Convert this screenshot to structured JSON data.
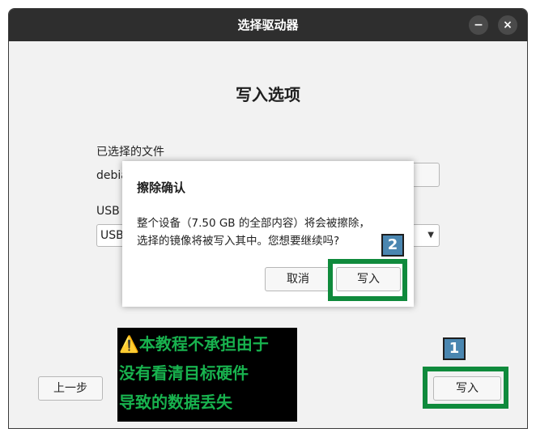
{
  "window": {
    "title": "选择驱动器",
    "minimize_label": "−",
    "close_label": "×"
  },
  "main": {
    "heading": "写入选项",
    "selected_file_label": "已选择的文件",
    "selected_file_value": "debia",
    "browse_button_label": "…",
    "usb_label": "USB",
    "usb_select_value": "USB",
    "prev_button_label": "上一步",
    "write_button_label": "写入",
    "step_badge": "1"
  },
  "warning": {
    "icon": "⚠️",
    "lines": [
      "本教程不承担由于",
      "没有看清目标硬件",
      "导致的数据丢失"
    ]
  },
  "dialog": {
    "title": "擦除确认",
    "message_line1": "整个设备（7.50 GB 的全部内容）将会被擦除，",
    "message_line2": "选择的镜像将被写入其中。您想要继续吗?",
    "cancel_label": "取消",
    "confirm_label": "写入",
    "step_badge": "2"
  },
  "colors": {
    "titlebar": "#2e2e2e",
    "highlight_frame": "#0f8a3c",
    "warning_text": "#18b24e",
    "badge": "#4a86b0"
  }
}
